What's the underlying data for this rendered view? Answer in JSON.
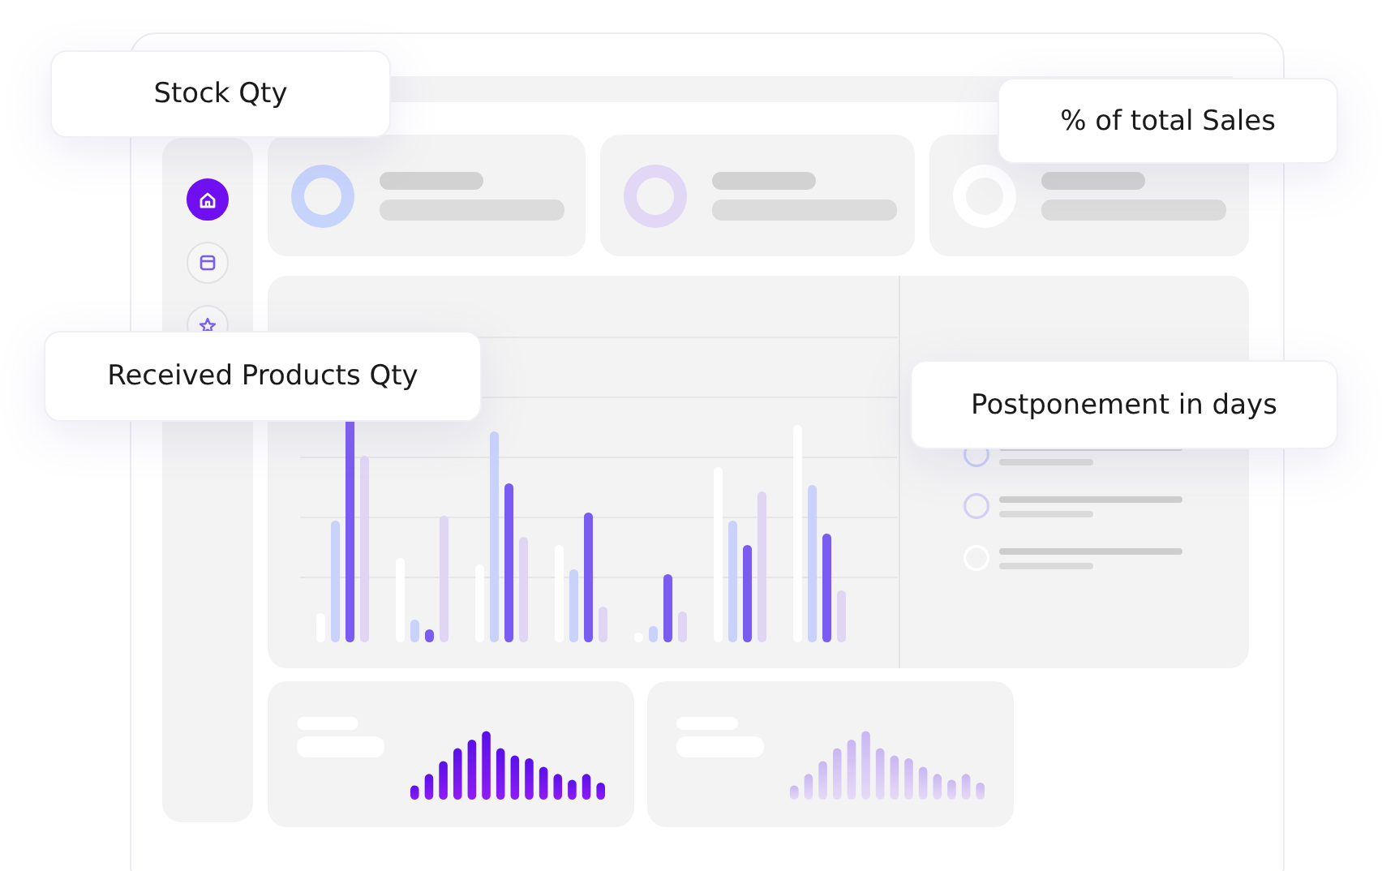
{
  "sidebar": {
    "items": [
      {
        "kind": "home",
        "selected": true
      },
      {
        "kind": "window",
        "selected": false
      },
      {
        "kind": "star",
        "selected": false
      }
    ]
  },
  "callouts": [
    {
      "text": "Stock Qty"
    },
    {
      "text": "% of total Sales"
    },
    {
      "text": "Received Products Qty"
    },
    {
      "text": "Postponement in days"
    }
  ]
}
